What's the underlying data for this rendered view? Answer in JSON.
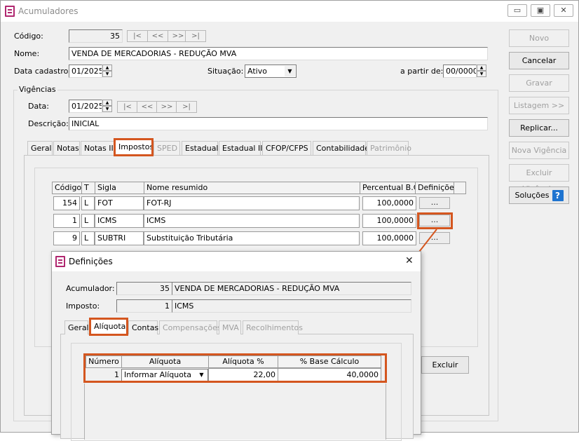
{
  "window": {
    "title": "Acumuladores",
    "min_glyph": "▭",
    "max_glyph": "▣",
    "close_glyph": "✕"
  },
  "form": {
    "codigo_label": "Código:",
    "codigo_value": "35",
    "nav": [
      "|<",
      "<<",
      ">>",
      ">|"
    ],
    "nome_label": "Nome:",
    "nome_value": "VENDA DE MERCADORIAS - REDUÇÃO MVA",
    "data_cadastro_label": "Data cadastro:",
    "data_cadastro_value": "01/2025",
    "situacao_label": "Situação:",
    "situacao_value": "Ativo",
    "a_partir_label": "a partir de:",
    "a_partir_value": "00/0000"
  },
  "vigencias": {
    "group_label": "Vigências",
    "data_label": "Data:",
    "data_value": "01/2025",
    "descricao_label": "Descrição:",
    "descricao_value": "INICIAL"
  },
  "tabs": [
    {
      "label": "Geral",
      "state": "normal"
    },
    {
      "label": "Notas",
      "state": "normal"
    },
    {
      "label": "Notas II",
      "state": "normal"
    },
    {
      "label": "Impostos",
      "state": "active"
    },
    {
      "label": "SPED",
      "state": "disabled"
    },
    {
      "label": "Estadual",
      "state": "normal"
    },
    {
      "label": "Estadual II",
      "state": "normal"
    },
    {
      "label": "CFOP/CFPS",
      "state": "normal"
    },
    {
      "label": "Contabilidade",
      "state": "normal"
    },
    {
      "label": "Patrimônio",
      "state": "disabled"
    }
  ],
  "impostos_table": {
    "headers": [
      "Código",
      "T",
      "Sigla",
      "Nome resumido",
      "Percentual B.C.",
      "Definições"
    ],
    "rows": [
      {
        "codigo": "154",
        "t": "L",
        "sigla": "FOT",
        "nome": "FOT-RJ",
        "percentual": "100,0000",
        "def": "..."
      },
      {
        "codigo": "1",
        "t": "L",
        "sigla": "ICMS",
        "nome": "ICMS",
        "percentual": "100,0000",
        "def": "..."
      },
      {
        "codigo": "9",
        "t": "L",
        "sigla": "SUBTRI",
        "nome": "Substituição Tributária",
        "percentual": "100,0000",
        "def": "..."
      }
    ]
  },
  "side_buttons": {
    "novo": "Novo",
    "cancelar": "Cancelar",
    "gravar": "Gravar",
    "listagem": "Listagem >>",
    "replicar": "Replicar...",
    "nova_vigencia": "Nova Vigência",
    "excluir_vigencia": "Excluir Vigência",
    "solucoes": "Soluções",
    "help": "?"
  },
  "excluir_button": "Excluir",
  "dialog": {
    "title": "Definições",
    "close_glyph": "✕",
    "acumulador_label": "Acumulador:",
    "acumulador_code": "35",
    "acumulador_name": "VENDA DE MERCADORIAS - REDUÇÃO MVA",
    "imposto_label": "Imposto:",
    "imposto_code": "1",
    "imposto_name": "ICMS",
    "tabs": [
      {
        "label": "Geral",
        "state": "normal"
      },
      {
        "label": "Alíquota",
        "state": "active"
      },
      {
        "label": "Contas",
        "state": "normal"
      },
      {
        "label": "Compensações",
        "state": "disabled"
      },
      {
        "label": "MVA",
        "state": "disabled"
      },
      {
        "label": "Recolhimentos",
        "state": "disabled"
      }
    ],
    "table": {
      "headers": [
        "Número",
        "Alíquota",
        "Alíquota %",
        "% Base Cálculo"
      ],
      "row": {
        "numero": "1",
        "aliquota": "Informar Alíquota",
        "aliquota_pct": "22,00",
        "base_calculo": "40,0000"
      }
    }
  },
  "colors": {
    "highlight": "#d4561f",
    "window_bg": "#f0f0f0",
    "icon_accent": "#b0276f",
    "help_blue": "#1e74d0"
  }
}
